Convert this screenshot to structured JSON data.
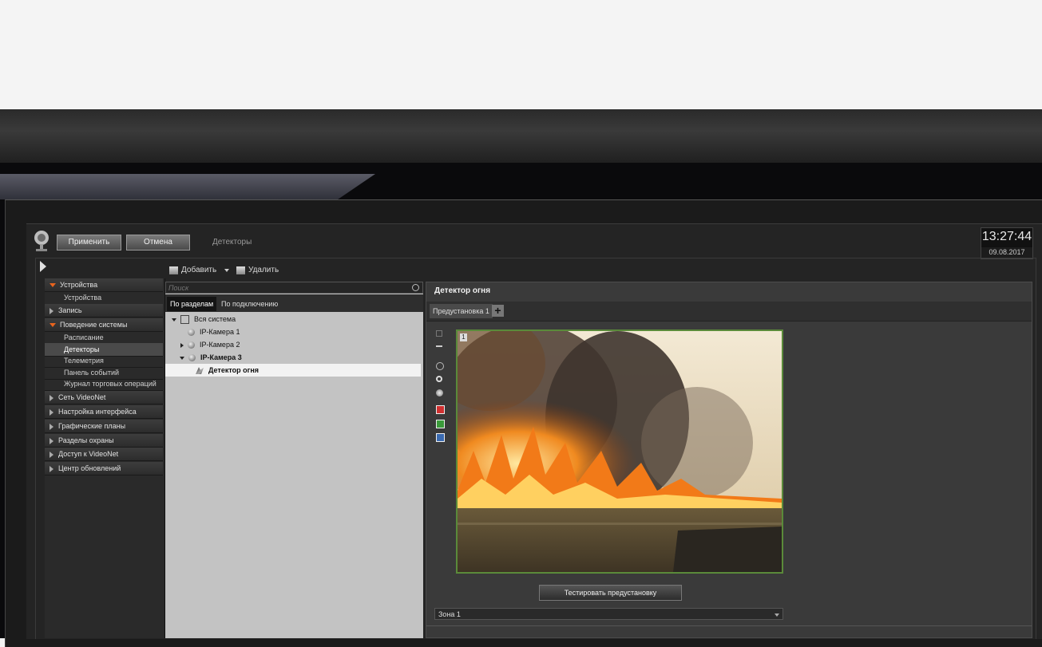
{
  "header": {
    "apply_label": "Применить",
    "cancel_label": "Отмена",
    "section_title": "Детекторы"
  },
  "clock": {
    "time": "13:27:44",
    "date": "09.08.2017"
  },
  "toolbar": {
    "add_label": "Добавить",
    "delete_label": "Удалить"
  },
  "sidebar": {
    "items": [
      {
        "label": "Устройства",
        "kind": "section",
        "state": "open"
      },
      {
        "label": "Устройства",
        "kind": "child"
      },
      {
        "label": "Запись",
        "kind": "section",
        "state": "closed"
      },
      {
        "label": "Поведение системы",
        "kind": "section",
        "state": "open"
      },
      {
        "label": "Расписание",
        "kind": "child"
      },
      {
        "label": "Детекторы",
        "kind": "child",
        "selected": true
      },
      {
        "label": "Телеметрия",
        "kind": "child"
      },
      {
        "label": "Панель событий",
        "kind": "child"
      },
      {
        "label": "Журнал торговых операций",
        "kind": "child"
      },
      {
        "label": "Сеть VideoNet",
        "kind": "section",
        "state": "closed"
      },
      {
        "label": "Настройка интерфейса",
        "kind": "section",
        "state": "closed"
      },
      {
        "label": "Графические планы",
        "kind": "section",
        "state": "closed"
      },
      {
        "label": "Разделы охраны",
        "kind": "section",
        "state": "closed"
      },
      {
        "label": "Доступ к VideoNet",
        "kind": "section",
        "state": "closed"
      },
      {
        "label": "Центр обновлений",
        "kind": "section",
        "state": "closed"
      }
    ]
  },
  "search": {
    "placeholder": "Поиск",
    "value": ""
  },
  "tree_tabs": [
    {
      "label": "По разделам",
      "active": true
    },
    {
      "label": "По подключению",
      "active": false
    }
  ],
  "tree": {
    "root": "Вся система",
    "cameras": [
      "IP-Камера 1",
      "IP-Камера 2",
      "IP-Камера 3"
    ],
    "detector": "Детектор огня"
  },
  "detail": {
    "title": "Детектор огня",
    "preset_tab": "Предустановка 1",
    "add_preset": "+",
    "video_number": "1",
    "test_button": "Тестировать предустановку",
    "zone": "Зона 1"
  },
  "colors": {
    "accent_orange": "#e8641e",
    "video_border": "#5a8a3a",
    "red_zone": "#d03030",
    "green_zone": "#3a9a3a",
    "blue_zone": "#3a6ab0"
  }
}
